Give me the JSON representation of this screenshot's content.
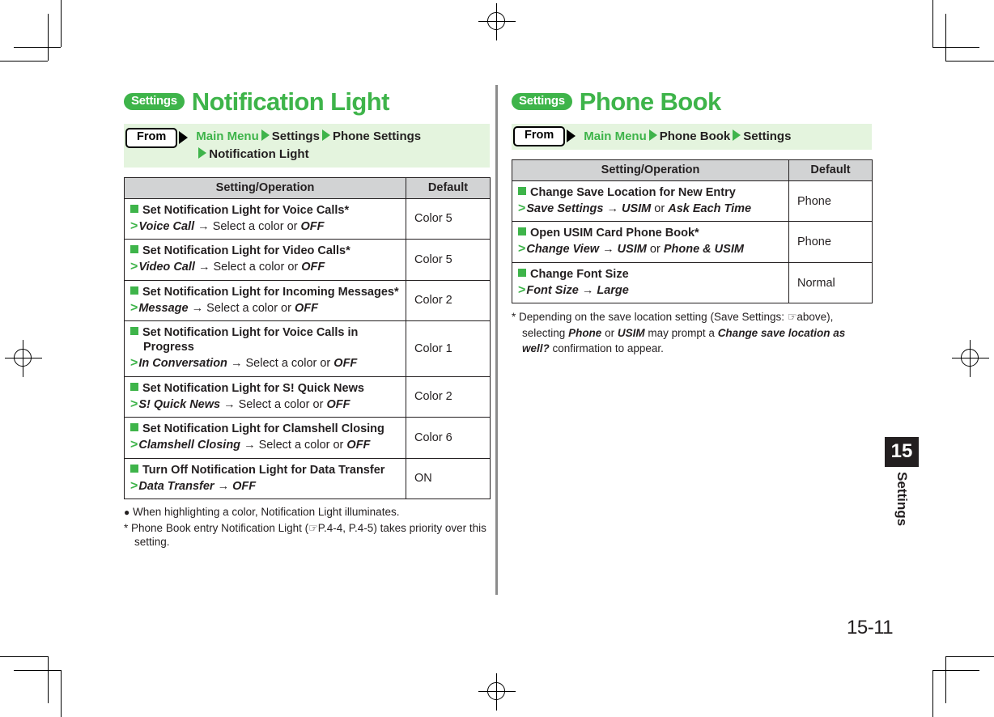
{
  "document": {
    "page_number": "15-11",
    "chapter_number": "15",
    "chapter_label": "Settings"
  },
  "left": {
    "badge": "Settings",
    "title": "Notification Light",
    "from_label": "From",
    "path_part_1": "Main Menu",
    "path_part_2": "Settings",
    "path_part_3": "Phone Settings",
    "path_part_4": "Notification Light",
    "table": {
      "headers": [
        "Setting/Operation",
        "Default"
      ],
      "rows": [
        {
          "title": "Set Notification Light for Voice Calls*",
          "operation_item": "Voice Call",
          "operation_rest": "Select a color or",
          "operation_tail": "OFF",
          "default": "Color 5"
        },
        {
          "title": "Set Notification Light for Video Calls*",
          "operation_item": "Video Call",
          "operation_rest": "Select a color or",
          "operation_tail": "OFF",
          "default": "Color 5"
        },
        {
          "title": "Set Notification Light for Incoming Messages*",
          "operation_item": "Message",
          "operation_rest": "Select a color or",
          "operation_tail": "OFF",
          "default": "Color 2"
        },
        {
          "title": "Set Notification Light for Voice Calls in Progress",
          "operation_item": "In Conversation",
          "operation_rest": "Select a color or",
          "operation_tail": "OFF",
          "default": "Color 1"
        },
        {
          "title": "Set Notification Light for S! Quick News",
          "operation_item": "S! Quick News",
          "operation_rest": "Select a color or",
          "operation_tail": "OFF",
          "default": "Color 2"
        },
        {
          "title": "Set Notification Light for Clamshell Closing",
          "operation_item": "Clamshell Closing",
          "operation_rest": "Select a color or",
          "operation_tail": "OFF",
          "default": "Color 6"
        },
        {
          "title": "Turn Off Notification Light for Data Transfer",
          "operation_item": "Data Transfer",
          "operation_rest": "",
          "operation_tail": "OFF",
          "default": "ON"
        }
      ]
    },
    "notes": {
      "bullet_note": "When highlighting a color, Notification Light illuminates.",
      "asterisk_note_a": "Phone Book entry Notification Light (",
      "asterisk_note_ref": "P.4-4, P.4-5",
      "asterisk_note_b": ") takes priority over this setting."
    }
  },
  "right": {
    "badge": "Settings",
    "title": "Phone Book",
    "from_label": "From",
    "path_part_1": "Main Menu",
    "path_part_2": "Phone Book",
    "path_part_3": "Settings",
    "table": {
      "headers": [
        "Setting/Operation",
        "Default"
      ],
      "rows": [
        {
          "title": "Change Save Location for New Entry",
          "operation_item": "Save Settings",
          "operation_opt_1": "USIM",
          "operation_or": "or",
          "operation_opt_2": "Ask Each Time",
          "default": "Phone"
        },
        {
          "title": "Open USIM Card Phone Book*",
          "operation_item": "Change View",
          "operation_opt_1": "USIM",
          "operation_or": "or",
          "operation_opt_2": "Phone & USIM",
          "default": "Phone"
        },
        {
          "title": "Change Font Size",
          "operation_item": "Font Size",
          "operation_opt_1": "Large",
          "operation_or": "",
          "operation_opt_2": "",
          "default": "Normal"
        }
      ]
    },
    "note": {
      "part_a": "Depending on the save location setting (Save Settings:",
      "part_ref": "above",
      "part_b": "), selecting",
      "bold_1": "Phone",
      "part_c": "or",
      "bold_2": "USIM",
      "part_d": "may prompt a",
      "bold_3": "Change save location as well?",
      "part_e": "confirmation to appear."
    }
  },
  "colors": {
    "brand_green": "#3eb44a",
    "from_bar_bg": "#e4f4de",
    "table_header_bg": "#d2d3d4",
    "ink": "#231f20"
  }
}
